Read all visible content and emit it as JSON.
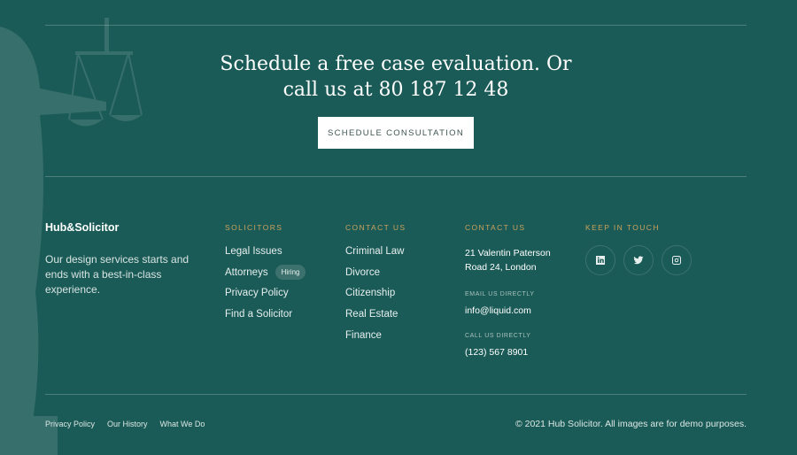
{
  "cta": {
    "heading_line1": "Schedule a free case evaluation. Or",
    "heading_line2": "call us at 80 187 12 48",
    "button_label": "SCHEDULE CONSULTATION"
  },
  "brand": {
    "logo": "Hub&Solicitor",
    "about": "Our design services starts and ends with a best-in-class experience."
  },
  "solicitors": {
    "heading": "SOLICITORS",
    "items": [
      {
        "label": "Legal Issues"
      },
      {
        "label": "Attorneys",
        "badge": "Hiring"
      },
      {
        "label": "Privacy Policy"
      },
      {
        "label": "Find a Solicitor"
      }
    ]
  },
  "contact_links": {
    "heading": "CONTACT US",
    "items": [
      "Criminal Law",
      "Divorce",
      "Citizenship",
      "Real Estate",
      "Finance"
    ]
  },
  "contact_info": {
    "heading": "CONTACT US",
    "address_line1": "21 Valentin Paterson",
    "address_line2": "Road 24, London",
    "email_label": "EMAIL US DIRECTLY",
    "email": "info@liquid.com",
    "phone_label": "CALL US DIRECTLY",
    "phone": "(123) 567 8901"
  },
  "keep_in_touch": {
    "heading": "KEEP IN TOUCH",
    "icons": [
      "linkedin-icon",
      "twitter-icon",
      "instagram-icon"
    ]
  },
  "footer": {
    "links": [
      "Privacy Policy",
      "Our History",
      "What We Do"
    ],
    "copyright": "© 2021 Hub Solicitor. All images are for demo purposes."
  },
  "colors": {
    "background": "#1b5b57",
    "accent_gold": "#c9a15b",
    "button_bg": "#ffffff"
  }
}
